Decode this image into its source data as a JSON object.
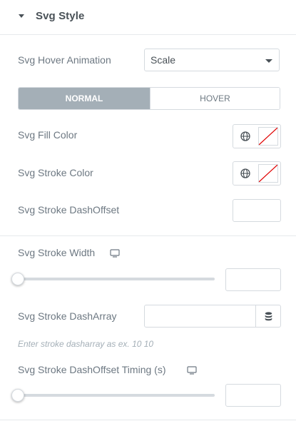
{
  "section": {
    "title": "Svg Style"
  },
  "hover_animation": {
    "label": "Svg Hover Animation",
    "value": "Scale"
  },
  "tabs": {
    "normal": "NORMAL",
    "hover": "HOVER"
  },
  "fill_color": {
    "label": "Svg Fill Color"
  },
  "stroke_color": {
    "label": "Svg Stroke Color"
  },
  "dash_offset": {
    "label": "Svg Stroke DashOffset",
    "value": ""
  },
  "stroke_width": {
    "label": "Svg Stroke Width",
    "value": "",
    "slider_level": 0
  },
  "dash_array": {
    "label": "Svg Stroke DashArray",
    "value": "",
    "hint": "Enter stroke dasharray as ex. 10 10"
  },
  "dash_offset_timing": {
    "label": "Svg Stroke DashOffset Timing (s)",
    "value": "",
    "slider_level": 0
  },
  "icons": {
    "caret": "caret-down-icon",
    "select_arrow": "chevron-down-icon",
    "globe": "globe-icon",
    "device": "desktop-icon",
    "database": "database-icon"
  },
  "colors": {
    "active_tab_bg": "#a4afb7",
    "border": "#d5dadf",
    "text": "#6d7882",
    "title": "#495157",
    "no_color_slash": "#e00000"
  }
}
